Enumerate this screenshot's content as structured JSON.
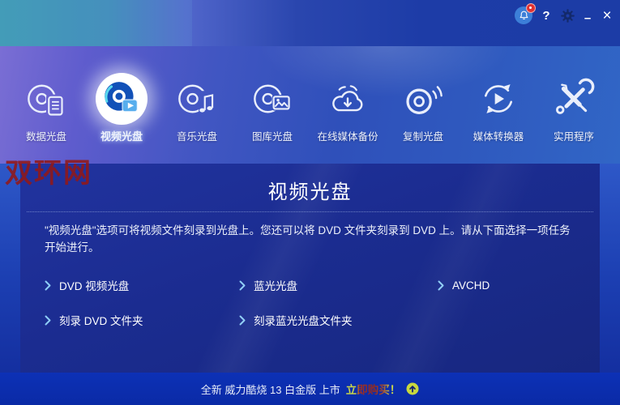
{
  "titlebar": {
    "help_label": "?",
    "minimize_label": "–",
    "close_label": "×",
    "icons": [
      "bell-icon",
      "help-icon",
      "gear-icon",
      "minimize-icon",
      "close-icon"
    ],
    "notification_badge": "unread"
  },
  "tabs": [
    {
      "label": "数据光盘",
      "icon": "data-disc-icon",
      "selected": false
    },
    {
      "label": "视频光盘",
      "icon": "video-disc-icon",
      "selected": true
    },
    {
      "label": "音乐光盘",
      "icon": "music-disc-icon",
      "selected": false
    },
    {
      "label": "图库光盘",
      "icon": "gallery-disc-icon",
      "selected": false
    },
    {
      "label": "在线媒体备份",
      "icon": "cloud-backup-icon",
      "selected": false
    },
    {
      "label": "复制光盘",
      "icon": "copy-disc-icon",
      "selected": false
    },
    {
      "label": "媒体转换器",
      "icon": "media-converter-icon",
      "selected": false
    },
    {
      "label": "实用程序",
      "icon": "utilities-icon",
      "selected": false
    }
  ],
  "watermark": {
    "text": "双环网",
    "color": "#921818"
  },
  "panel": {
    "title": "视频光盘",
    "description": "\"视频光盘\"选项可将视频文件刻录到光盘上。您还可以将 DVD 文件夹刻录到 DVD 上。请从下面选择一项任务开始进行。",
    "tasks": [
      {
        "label": "DVD 视频光盘",
        "icon": "chevron-right-icon"
      },
      {
        "label": "蓝光光盘",
        "icon": "chevron-right-icon"
      },
      {
        "label": "AVCHD",
        "icon": "chevron-right-icon"
      },
      {
        "label": "刻录 DVD 文件夹",
        "icon": "chevron-right-icon"
      },
      {
        "label": "刻录蓝光光盘文件夹",
        "icon": "chevron-right-icon"
      }
    ]
  },
  "footer": {
    "promo_text": "全新 威力酷烧 13 白金版 上市",
    "buy_label": "立即购买！",
    "icon": "arrow-up-circle-icon"
  },
  "colors": {
    "titlebar_blue": "#1c3ca6",
    "band_violet": "#7a6ed4",
    "panel_navy": "#1b2c90",
    "bottom_blue": "#0b2eb0",
    "accent_yellow": "#ccd84a",
    "chevron_blue": "#8ecdf6",
    "watermark_red": "#921818"
  }
}
